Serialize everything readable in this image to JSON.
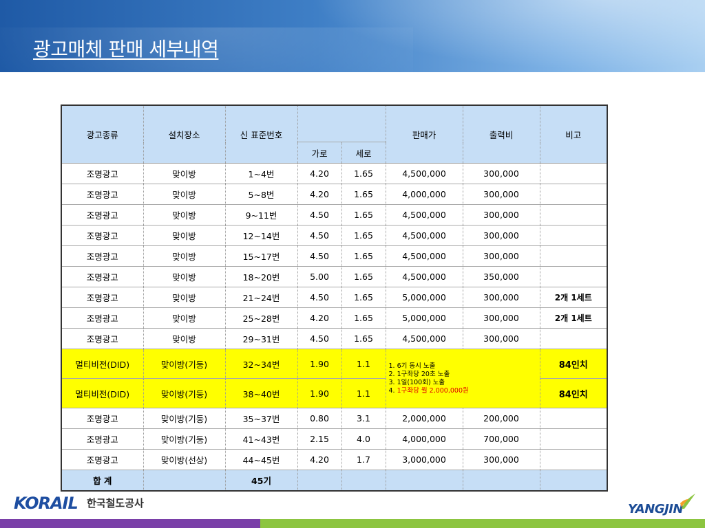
{
  "title": "광고매체 판매 세부내역",
  "table": {
    "headers": {
      "type": "광고종류",
      "location": "설치장소",
      "number": "신 표준번호",
      "width": "가로",
      "height": "세로",
      "price": "판매가",
      "print_cost": "출력비",
      "remark": "비고"
    },
    "rows": [
      {
        "type": "조명광고",
        "location": "맞이방",
        "number": "1~4번",
        "width": "4.20",
        "height": "1.65",
        "price": "4,500,000",
        "print_cost": "300,000",
        "remark": ""
      },
      {
        "type": "조명광고",
        "location": "맞이방",
        "number": "5~8번",
        "width": "4.20",
        "height": "1.65",
        "price": "4,000,000",
        "print_cost": "300,000",
        "remark": ""
      },
      {
        "type": "조명광고",
        "location": "맞이방",
        "number": "9~11번",
        "width": "4.50",
        "height": "1.65",
        "price": "4,500,000",
        "print_cost": "300,000",
        "remark": ""
      },
      {
        "type": "조명광고",
        "location": "맞이방",
        "number": "12~14번",
        "width": "4.50",
        "height": "1.65",
        "price": "4,500,000",
        "print_cost": "300,000",
        "remark": ""
      },
      {
        "type": "조명광고",
        "location": "맞이방",
        "number": "15~17번",
        "width": "4.50",
        "height": "1.65",
        "price": "4,500,000",
        "print_cost": "300,000",
        "remark": ""
      },
      {
        "type": "조명광고",
        "location": "맞이방",
        "number": "18~20번",
        "width": "5.00",
        "height": "1.65",
        "price": "4,500,000",
        "print_cost": "350,000",
        "remark": ""
      },
      {
        "type": "조명광고",
        "location": "맞이방",
        "number": "21~24번",
        "width": "4.50",
        "height": "1.65",
        "price": "5,000,000",
        "print_cost": "300,000",
        "remark": "2개 1세트"
      },
      {
        "type": "조명광고",
        "location": "맞이방",
        "number": "25~28번",
        "width": "4.20",
        "height": "1.65",
        "price": "5,000,000",
        "print_cost": "300,000",
        "remark": "2개 1세트"
      },
      {
        "type": "조명광고",
        "location": "맞이방",
        "number": "29~31번",
        "width": "4.50",
        "height": "1.65",
        "price": "4,500,000",
        "print_cost": "300,000",
        "remark": ""
      }
    ],
    "did_rows": [
      {
        "type": "멀티비전(DID)",
        "location": "맞이방(기둥)",
        "number": "32~34번",
        "width": "1.90",
        "height": "1.1",
        "remark": "84인치"
      },
      {
        "type": "멀티비전(DID)",
        "location": "맞이방(기둥)",
        "number": "38~40번",
        "width": "1.90",
        "height": "1.1",
        "remark": "84인치"
      }
    ],
    "did_note": {
      "line1": "1. 6기 동시 노출",
      "line2": "2. 1구좌당 20초 노출",
      "line3": "3. 1일(100회) 노출",
      "line4_prefix": "4. ",
      "line4_red": "1구좌당 월 2,000,000원"
    },
    "rows_after": [
      {
        "type": "조명광고",
        "location": "맞이방(기둥)",
        "number": "35~37번",
        "width": "0.80",
        "height": "3.1",
        "price": "2,000,000",
        "print_cost": "200,000",
        "remark": ""
      },
      {
        "type": "조명광고",
        "location": "맞이방(기둥)",
        "number": "41~43번",
        "width": "2.15",
        "height": "4.0",
        "price": "4,000,000",
        "print_cost": "700,000",
        "remark": ""
      },
      {
        "type": "조명광고",
        "location": "맞이방(선상)",
        "number": "44~45번",
        "width": "4.20",
        "height": "1.7",
        "price": "3,000,000",
        "print_cost": "300,000",
        "remark": ""
      }
    ],
    "total": {
      "label": "합 계",
      "count": "45기"
    }
  },
  "footer": {
    "korail_logo": "KORAIL",
    "korail_name": "한국철도공사",
    "yangjin_logo": "YANGJIN"
  },
  "colors": {
    "header_blue": "#1f5aa6",
    "table_header": "#c6def6",
    "highlight": "#ffff00",
    "accent_red": "#e00000",
    "footer_purple": "#7a3fa8",
    "footer_green": "#8cc540"
  }
}
